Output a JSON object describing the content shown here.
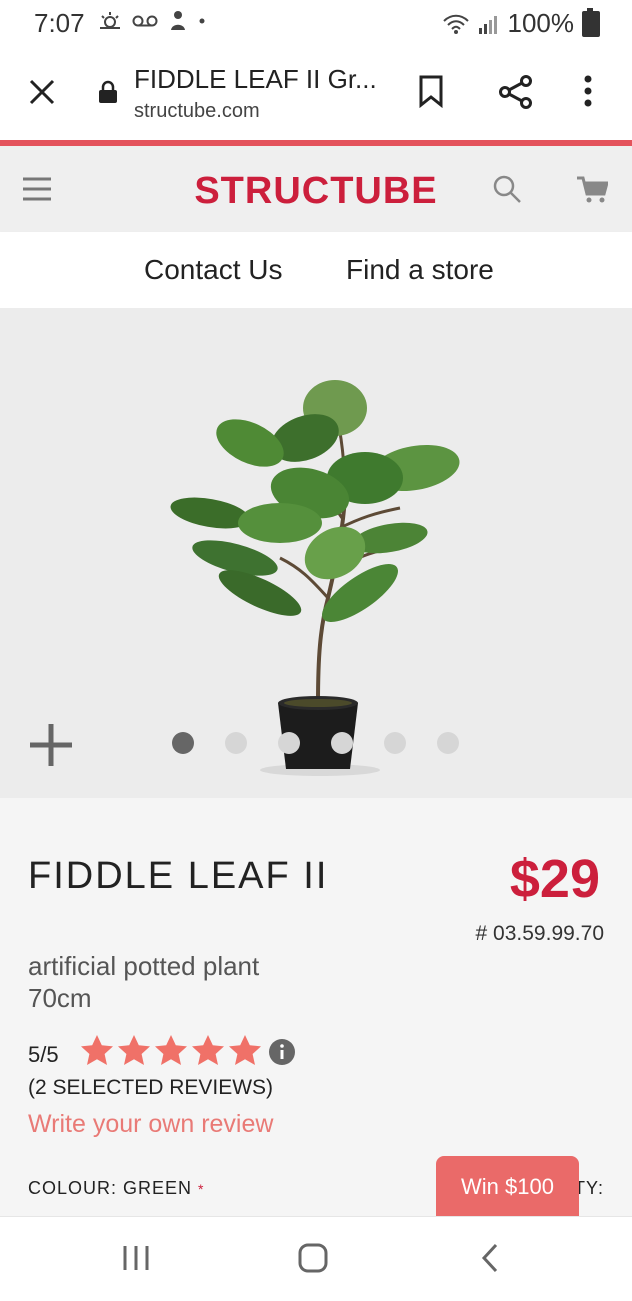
{
  "status_bar": {
    "time": "7:07",
    "battery": "100%"
  },
  "browser": {
    "page_title": "FIDDLE LEAF II Gr...",
    "url": "structube.com"
  },
  "header": {
    "logo": "STRUCTUBE"
  },
  "subnav": {
    "contact": "Contact Us",
    "store": "Find a store"
  },
  "gallery": {
    "dots": 6,
    "active_index": 0
  },
  "product": {
    "name": "FIDDLE LEAF II",
    "description": "artificial potted plant 70cm",
    "price": "$29",
    "sku": "# 03.59.99.70",
    "rating": "5/5",
    "stars": 5,
    "reviews": "(2 SELECTED REVIEWS)",
    "write_review": "Write your own review",
    "colour_label": "COLOUR: GREEN",
    "required_mark": "*",
    "qty_label": "TY:",
    "win_button": "Win $100"
  },
  "colors": {
    "brand": "#cc1f3c",
    "accent": "#e4535c",
    "star": "#f07168"
  }
}
